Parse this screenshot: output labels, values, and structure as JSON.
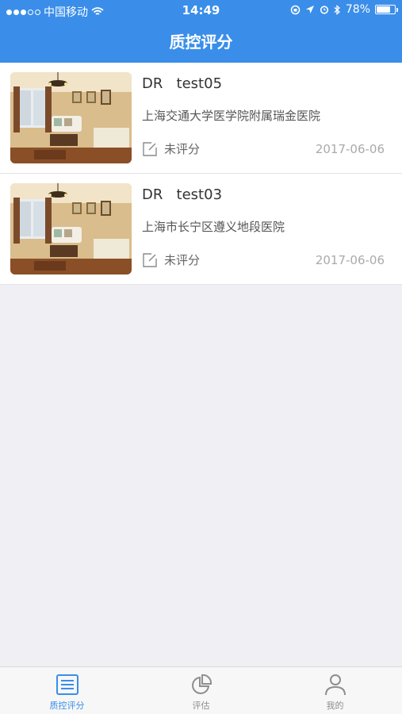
{
  "statusbar": {
    "carrier": "中国移动",
    "time": "14:49",
    "battery": "78%",
    "battery_level": 0.78
  },
  "navbar": {
    "title": "质控评分"
  },
  "items": [
    {
      "modality": "DR",
      "name": "test05",
      "hospital": "上海交通大学医学院附属瑞金医院",
      "status": "未评分",
      "date": "2017-06-06"
    },
    {
      "modality": "DR",
      "name": "test03",
      "hospital": "上海市长宁区遵义地段医院",
      "status": "未评分",
      "date": "2017-06-06"
    }
  ],
  "tabs": [
    {
      "label": "质控评分",
      "icon": "list-icon",
      "active": true
    },
    {
      "label": "评估",
      "icon": "pie-chart-icon",
      "active": false
    },
    {
      "label": "我的",
      "icon": "user-icon",
      "active": false
    }
  ],
  "colors": {
    "brand": "#3a8ee9",
    "background": "#efeff4"
  }
}
